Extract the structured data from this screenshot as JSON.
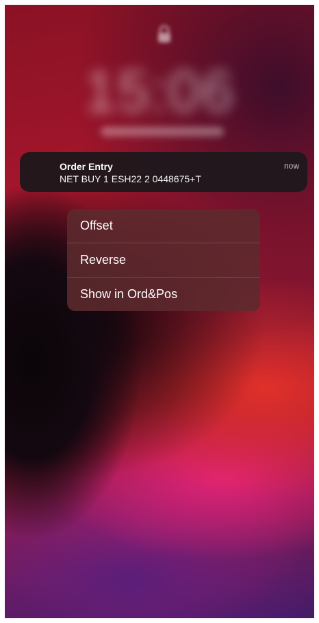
{
  "lockscreen": {
    "time": "15:06",
    "lock_icon": "lock-icon"
  },
  "notification": {
    "title": "Order Entry",
    "body": "NET BUY 1 ESH22 2 0448675+T",
    "time": "now"
  },
  "action_menu": {
    "items": [
      {
        "label": "Offset"
      },
      {
        "label": "Reverse"
      },
      {
        "label": "Show in Ord&Pos"
      }
    ]
  },
  "colors": {
    "wallpaper_red": "#a5162c",
    "wallpaper_dark": "#0a0508",
    "wallpaper_pink": "#e2237a",
    "wallpaper_purple": "#5a1e7a",
    "notification_bg": "#1e181c",
    "menu_bg": "#5c2a2e"
  }
}
